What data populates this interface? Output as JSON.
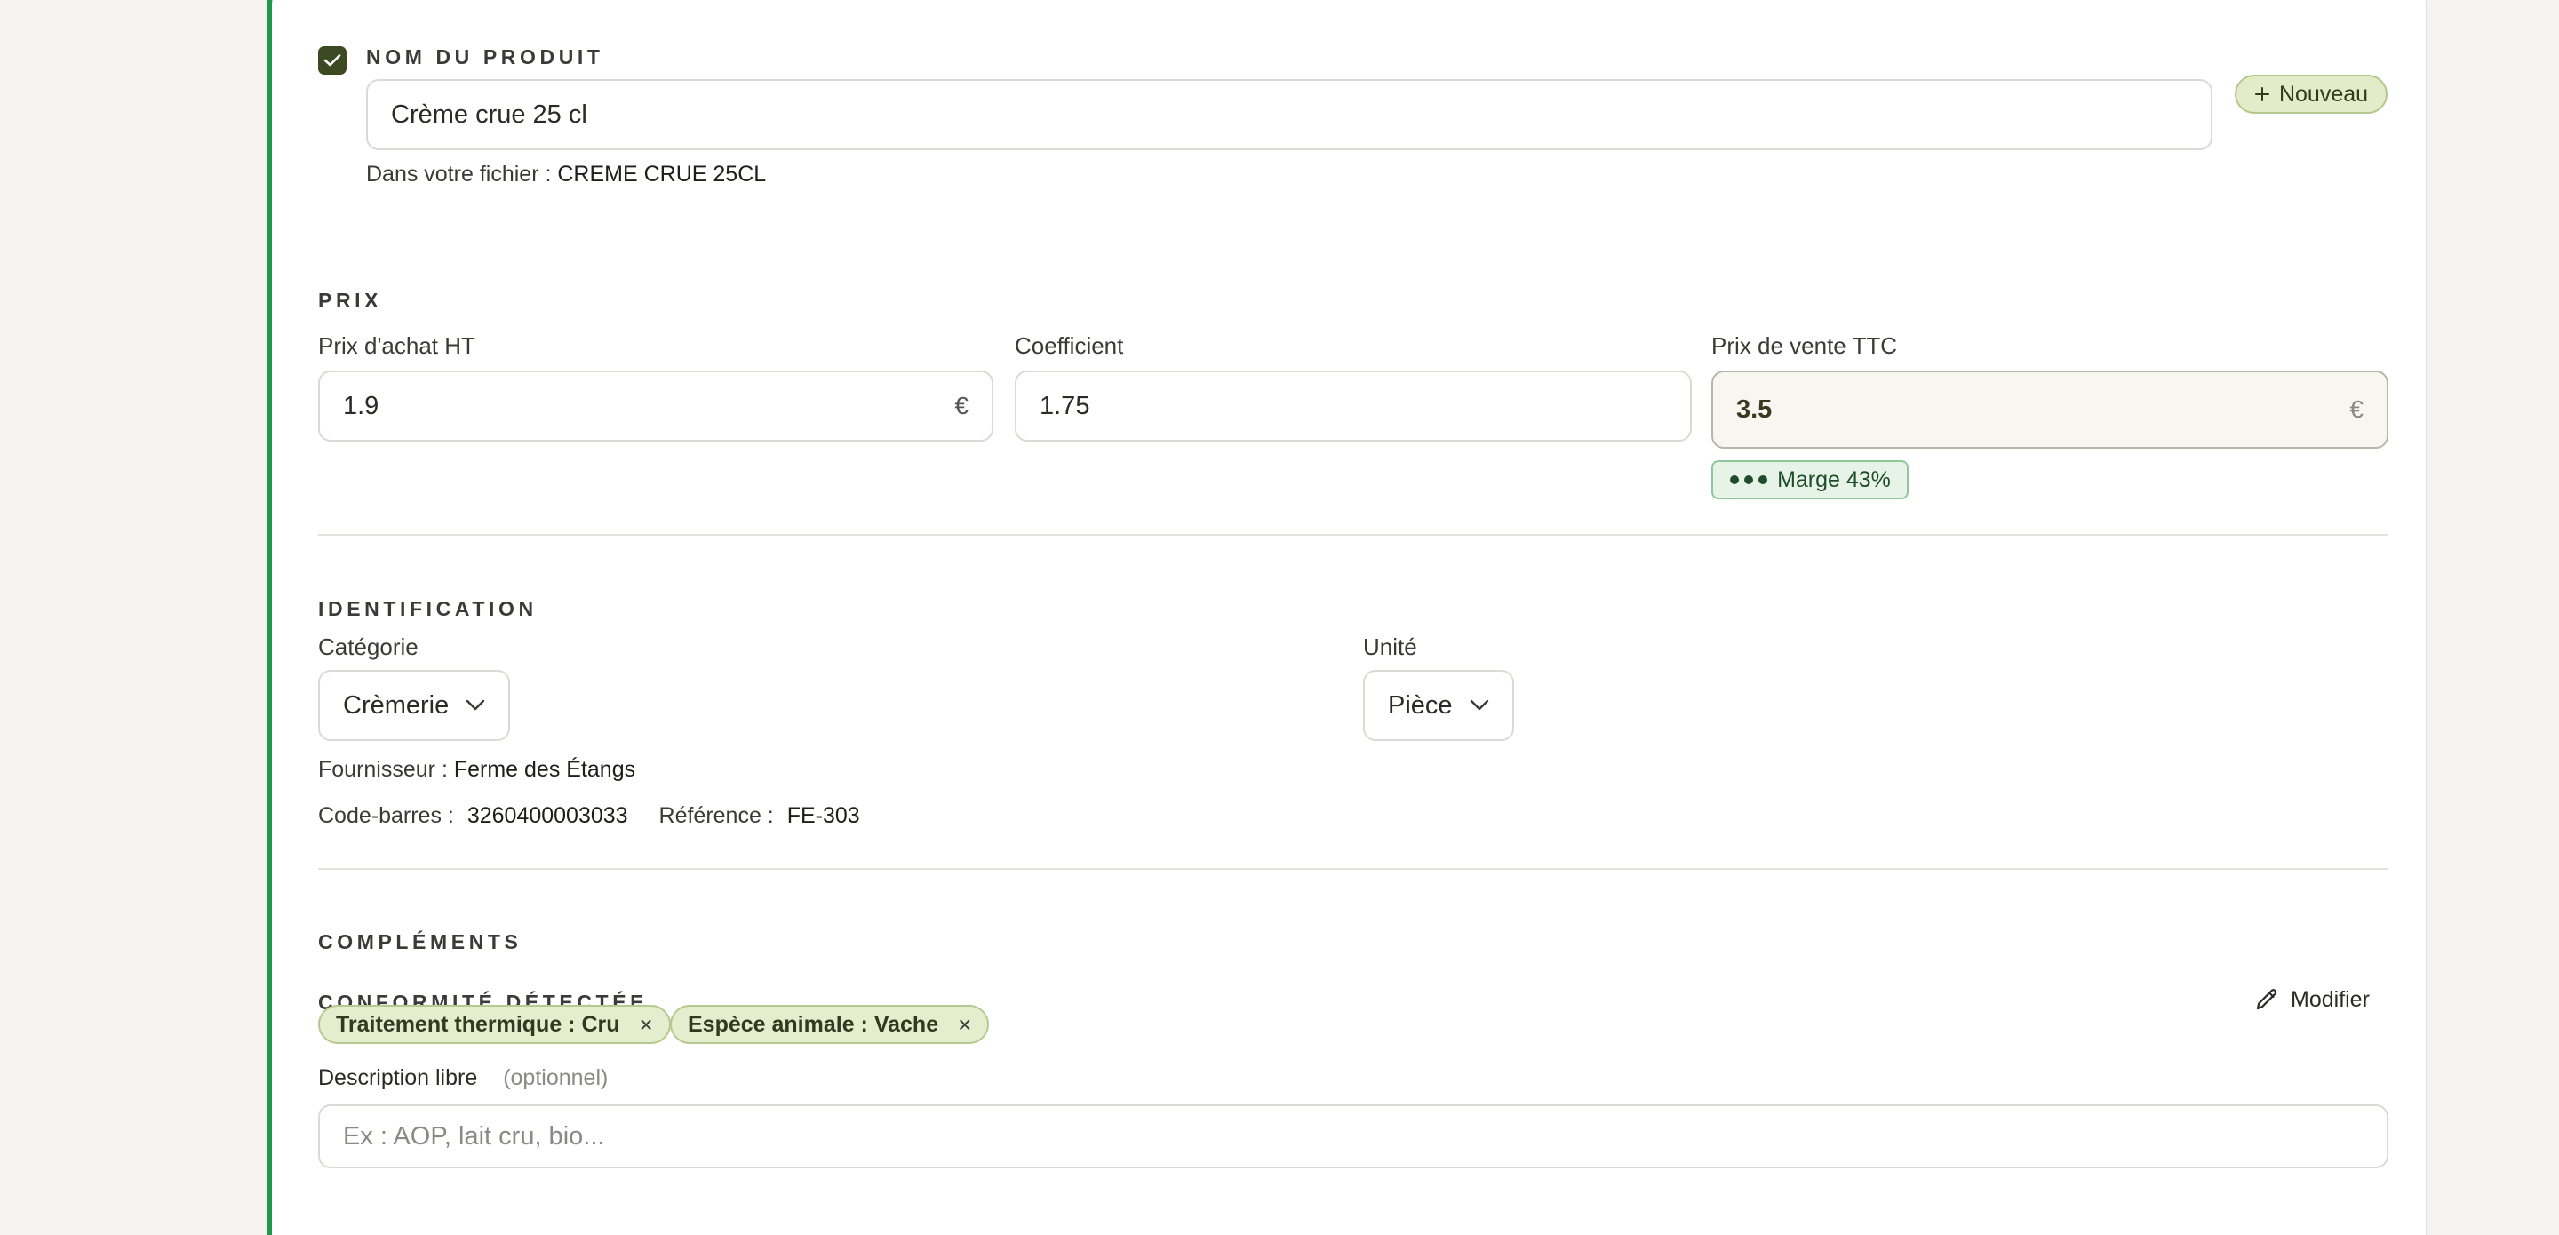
{
  "product": {
    "section_label": "NOM DU PRODUIT",
    "checked": true,
    "name_value": "Crème crue 25 cl",
    "file_hint_label": "Dans votre fichier :",
    "file_hint_value": "CREME CRUE 25CL",
    "new_badge": "Nouveau"
  },
  "prix": {
    "section_label": "PRIX",
    "achat_label": "Prix d'achat HT",
    "achat_value": "1.9",
    "achat_suffix": "€",
    "coef_label": "Coefficient",
    "coef_value": "1.75",
    "vente_label": "Prix de vente TTC",
    "vente_value": "3.5",
    "vente_suffix": "€",
    "margin_badge": "Marge 43%"
  },
  "identification": {
    "section_label": "IDENTIFICATION",
    "categorie_label": "Catégorie",
    "categorie_value": "Crèmerie",
    "unite_label": "Unité",
    "unite_value": "Pièce",
    "fournisseur_label": "Fournisseur :",
    "fournisseur_value": "Ferme des Étangs",
    "barcode_label": "Code-barres :",
    "barcode_value": "3260400003033",
    "reference_label": "Référence :",
    "reference_value": "FE-303"
  },
  "complements": {
    "section_label": "COMPLÉMENTS",
    "conformite_label": "CONFORMITÉ DÉTECTÉE",
    "modify_label": "Modifier",
    "tags": [
      {
        "label": "Traitement thermique : Cru",
        "remove": "×"
      },
      {
        "label": "Espèce animale : Vache",
        "remove": "×"
      }
    ],
    "description_label": "Description libre",
    "description_optional": "(optionnel)",
    "description_placeholder": "Ex : AOP, lait cru, bio..."
  },
  "colors": {
    "accent_green": "#1f9a4a",
    "checkbox": "#3b4a22",
    "tag_bg": "#e5edcf",
    "margin_bg": "#e6f3e6"
  }
}
